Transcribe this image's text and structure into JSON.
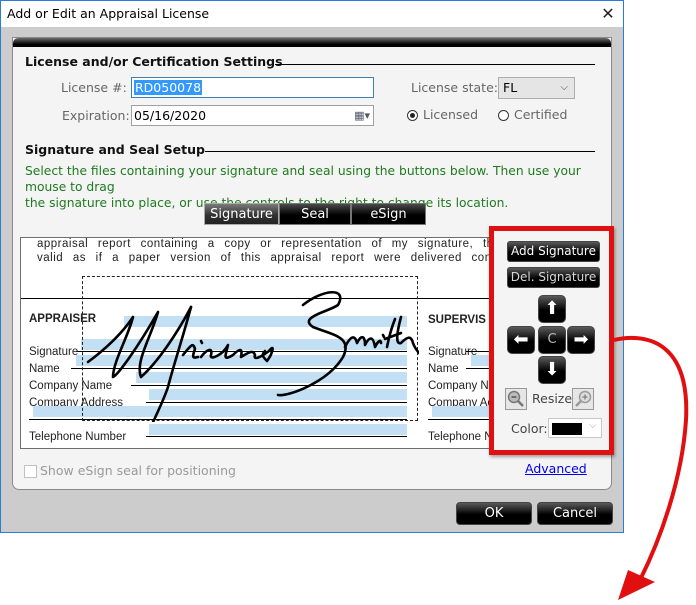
{
  "window": {
    "title": "Add or Edit an Appraisal License",
    "close_icon": "close-icon"
  },
  "license_section": {
    "title": "License and/or Certification Settings",
    "license_label": "License #:",
    "license_value": "RD050078",
    "expiration_label": "Expiration:",
    "expiration_value": "05/16/2020",
    "state_label": "License state:",
    "state_value": "FL",
    "type_options": [
      {
        "label": "Licensed",
        "selected": true
      },
      {
        "label": "Certified",
        "selected": false
      }
    ]
  },
  "signature_section": {
    "title": "Signature and Seal Setup",
    "instructions_line1": "Select the files containing your signature and seal using the buttons below. Then use your mouse to drag",
    "instructions_line2": "the signature into place, or use the controls to the right to change its location.",
    "tabs": [
      {
        "label": "Signature",
        "active": true
      },
      {
        "label": "Seal",
        "active": false
      },
      {
        "label": "eSign",
        "active": false
      }
    ]
  },
  "preview": {
    "text_line1": "appraisal report containing a copy or representation of my signature, the app",
    "text_line2": "valid as if a paper version of this appraisal report were delivered containi",
    "appraiser_heading": "APPRAISER",
    "supervisor_heading": "SUPERVIS",
    "appraiser_fields": [
      "Signature",
      "Name",
      "Company Name",
      "Company Address",
      "Telephone Number"
    ],
    "supervisor_fields": [
      "Signature",
      "Name",
      "Company N",
      "Company Ad",
      "Telephone N"
    ],
    "signature_text": "Michael Smith"
  },
  "controls": {
    "add_signature": "Add Signature",
    "del_signature": "Del. Signature",
    "center_label": "C",
    "resize_label": "Resize",
    "color_label": "Color:",
    "color_value": "#000000"
  },
  "footer": {
    "esign_checkbox_label": "Show eSign seal for positioning",
    "esign_checked": false,
    "advanced_link": "Advanced",
    "ok": "OK",
    "cancel": "Cancel"
  },
  "annotation": {
    "highlight_color": "#e01010"
  }
}
